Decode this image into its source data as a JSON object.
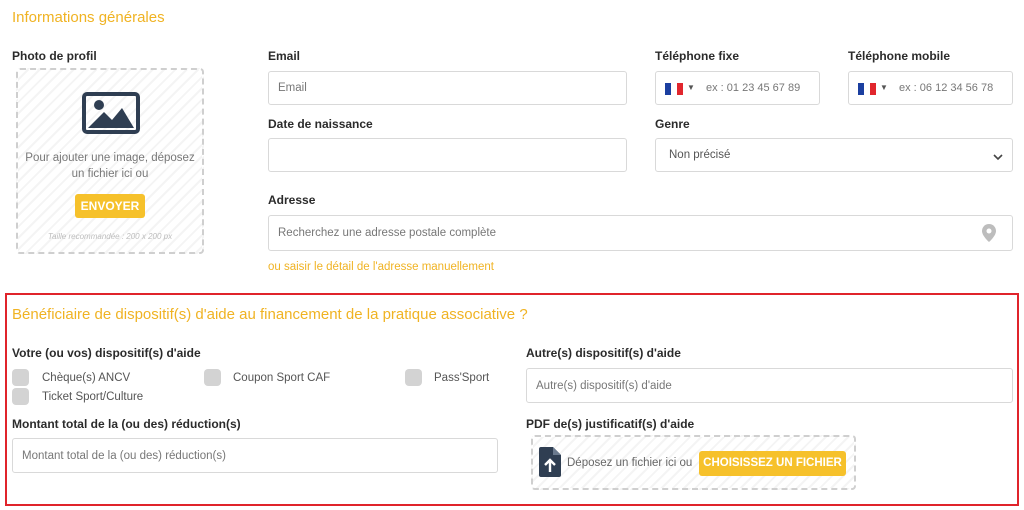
{
  "general": {
    "title": "Informations générales",
    "photo": {
      "label": "Photo de profil",
      "hint": "Pour ajouter une image, déposez un fichier ici ou",
      "button": "ENVOYER",
      "size_note": "Taille recommandée : 200 x 200 px"
    },
    "email": {
      "label": "Email",
      "placeholder": "Email"
    },
    "phone_fixed": {
      "label": "Téléphone fixe",
      "placeholder": "ex : 01 23 45 67 89"
    },
    "phone_mobile": {
      "label": "Téléphone mobile",
      "placeholder": "ex : 06 12 34 56 78"
    },
    "birthdate": {
      "label": "Date de naissance",
      "value": ""
    },
    "gender": {
      "label": "Genre",
      "value": "Non précisé"
    },
    "address": {
      "label": "Adresse",
      "placeholder": "Recherchez une adresse postale complète",
      "manual_link": "ou saisir le détail de l'adresse manuellement"
    }
  },
  "aid": {
    "title": "Bénéficiaire de dispositif(s) d'aide au financement de la pratique associative ?",
    "devices_label": "Votre (ou vos) dispositif(s) d'aide",
    "options": [
      "Chèque(s) ANCV",
      "Coupon Sport CAF",
      "Pass'Sport",
      "Ticket Sport/Culture"
    ],
    "other": {
      "label": "Autre(s) dispositif(s) d'aide",
      "placeholder": "Autre(s) dispositif(s) d'aide"
    },
    "amount": {
      "label": "Montant total de la (ou des) réduction(s)",
      "placeholder": "Montant total de la (ou des) réduction(s)"
    },
    "pdf": {
      "label": "PDF de(s) justificatif(s) d'aide",
      "hint": "Déposez un fichier ici ou",
      "button": "CHOISISSEZ UN FICHIER"
    }
  },
  "colors": {
    "accent": "#f0b323",
    "button": "#f6c12b",
    "highlight": "#e0242b",
    "flag": [
      "#1b3fa0",
      "#ffffff",
      "#e1262d"
    ]
  }
}
